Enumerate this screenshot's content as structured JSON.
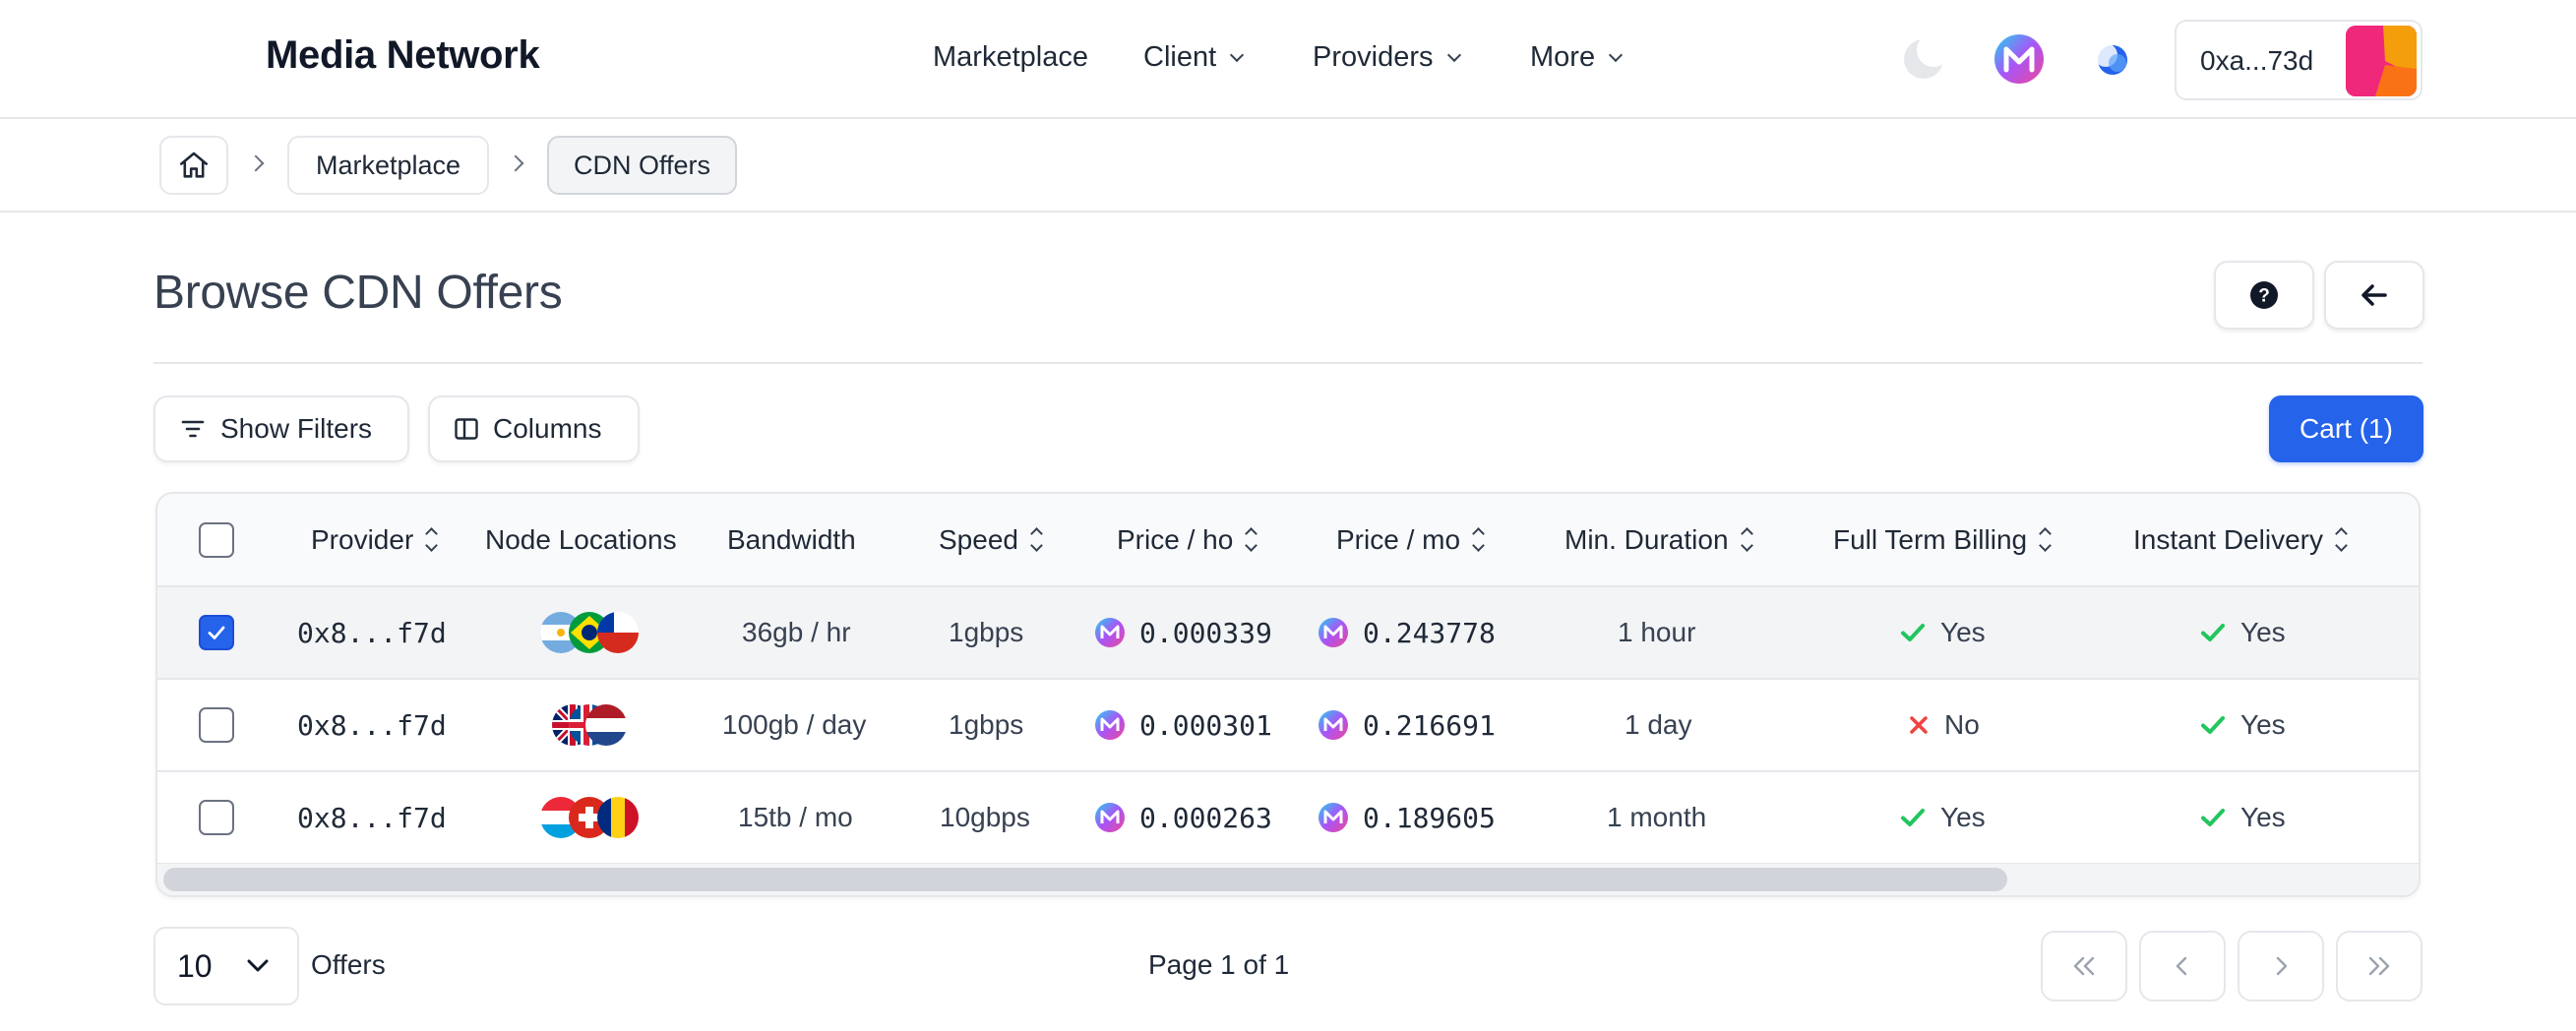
{
  "header": {
    "brand": "Media Network",
    "nav": [
      {
        "label": "Marketplace",
        "has_dropdown": false
      },
      {
        "label": "Client",
        "has_dropdown": true
      },
      {
        "label": "Providers",
        "has_dropdown": true
      },
      {
        "label": "More",
        "has_dropdown": true
      }
    ],
    "icons": [
      "moon-icon",
      "media-network-logo-icon",
      "network-status-icon"
    ],
    "wallet_address": "0xa...73d"
  },
  "breadcrumb": {
    "home_icon": "home-icon",
    "items": [
      "Marketplace",
      "CDN Offers"
    ]
  },
  "page": {
    "title": "Browse CDN Offers",
    "help_icon": "question-circle-icon",
    "back_icon": "arrow-left-icon"
  },
  "toolbar": {
    "filters_label": "Show Filters",
    "columns_label": "Columns",
    "cart_label": "Cart (1)"
  },
  "table": {
    "columns": [
      "Provider",
      "Node Locations",
      "Bandwidth",
      "Speed",
      "Price / ho",
      "Price / mo",
      "Min. Duration",
      "Full Term Billing",
      "Instant Delivery"
    ],
    "rows": [
      {
        "selected": true,
        "provider": "0x8...f7d",
        "flags": [
          "Argentina",
          "Brazil",
          "Chile"
        ],
        "bandwidth": "36gb / hr",
        "speed": "1gbps",
        "price_ho": "0.000339",
        "price_mo": "0.243778",
        "min_duration": "1 hour",
        "full_term_billing": "Yes",
        "full_term_ok": true,
        "instant_delivery": "Yes",
        "instant_ok": true
      },
      {
        "selected": false,
        "provider": "0x8...f7d",
        "flags": [
          "United Kingdom",
          "Iceland",
          "Netherlands"
        ],
        "bandwidth": "100gb / day",
        "speed": "1gbps",
        "price_ho": "0.000301",
        "price_mo": "0.216691",
        "min_duration": "1 day",
        "full_term_billing": "No",
        "full_term_ok": false,
        "instant_delivery": "Yes",
        "instant_ok": true
      },
      {
        "selected": false,
        "provider": "0x8...f7d",
        "flags": [
          "Luxembourg",
          "Switzerland",
          "Romania"
        ],
        "bandwidth": "15tb / mo",
        "speed": "10gbps",
        "price_ho": "0.000263",
        "price_mo": "0.189605",
        "min_duration": "1 month",
        "full_term_billing": "Yes",
        "full_term_ok": true,
        "instant_delivery": "Yes",
        "instant_ok": true
      }
    ]
  },
  "footer": {
    "page_size": "10",
    "offers_label": "Offers",
    "page_info": "Page 1 of 1",
    "pagination_icons": [
      "chevrons-left-icon",
      "chevron-left-icon",
      "chevron-right-icon",
      "chevrons-right-icon"
    ]
  },
  "colors": {
    "primary": "#2563eb",
    "success": "#22c55e",
    "danger": "#ef4444",
    "border": "#e5e7eb"
  }
}
